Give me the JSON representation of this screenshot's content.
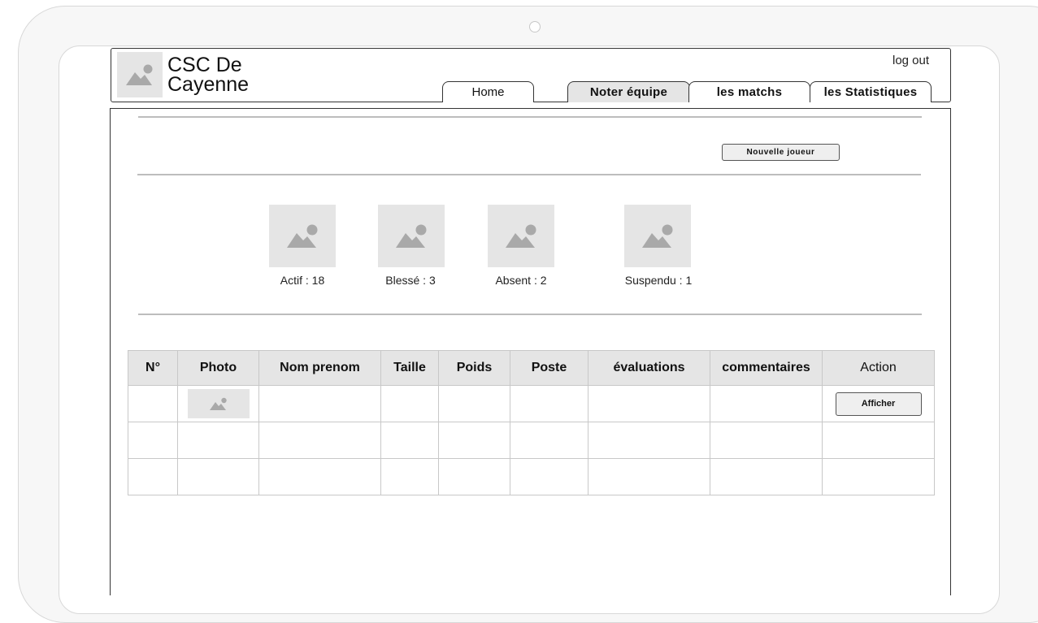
{
  "brand": {
    "line1": "CSC De",
    "line2": "Cayenne"
  },
  "header": {
    "logout_label": "log out"
  },
  "nav": {
    "tabs": [
      {
        "label": "Home"
      },
      {
        "label": "Noter équipe"
      },
      {
        "label": "les matchs"
      },
      {
        "label": "les Statistiques"
      }
    ]
  },
  "toolbar": {
    "new_player_label": "Nouvelle joueur"
  },
  "stats": [
    {
      "label": "Actif : 18"
    },
    {
      "label": "Blessé : 3"
    },
    {
      "label": "Absent : 2"
    },
    {
      "label": "Suspendu : 1"
    }
  ],
  "table": {
    "headers": [
      "N°",
      "Photo",
      "Nom prenom",
      "Taille",
      "Poids",
      "Poste",
      "évaluations",
      "commentaires",
      "Action"
    ],
    "row_action_label": "Afficher"
  },
  "icons": {
    "placeholder": "image-placeholder-icon"
  },
  "colors": {
    "placeholder_bg": "#e5e5e5",
    "placeholder_fg": "#a9a9a9",
    "divider": "#bdbdbd"
  }
}
